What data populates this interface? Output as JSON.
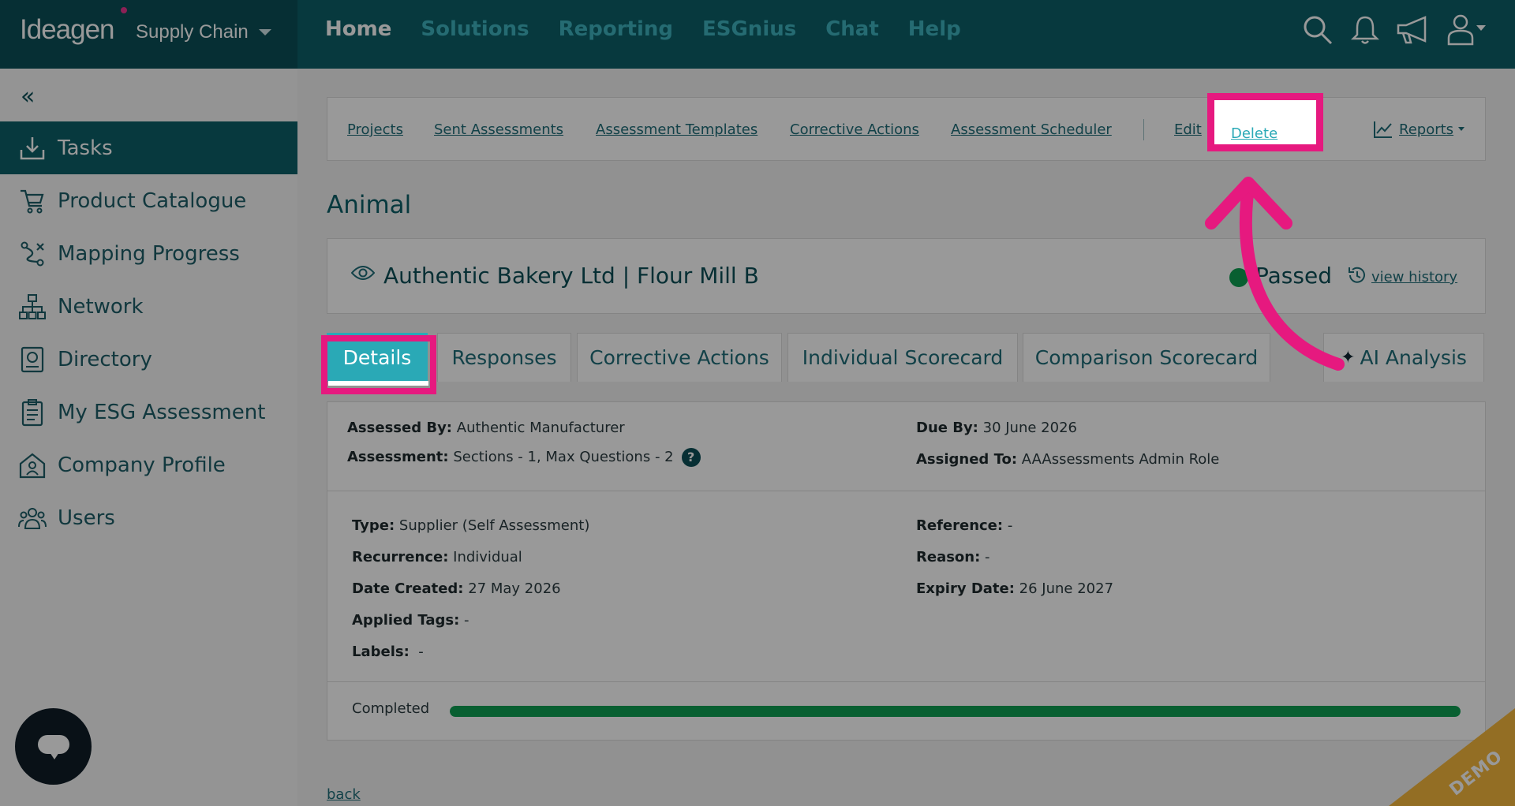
{
  "header": {
    "brand_logo": "Ideagen",
    "brand_product": "Supply Chain",
    "nav": [
      "Home",
      "Solutions",
      "Reporting",
      "ESGnius",
      "Chat",
      "Help"
    ],
    "active_nav": "Home",
    "icons": [
      "search-icon",
      "bell-icon",
      "megaphone-icon",
      "user-icon"
    ]
  },
  "sidebar": {
    "items": [
      {
        "label": "Tasks",
        "icon": "download-tray-icon",
        "active": true
      },
      {
        "label": "Product Catalogue",
        "icon": "cart-icon"
      },
      {
        "label": "Mapping Progress",
        "icon": "route-icon"
      },
      {
        "label": "Network",
        "icon": "network-icon"
      },
      {
        "label": "Directory",
        "icon": "directory-icon"
      },
      {
        "label": "My ESG Assessment",
        "icon": "clipboard-icon"
      },
      {
        "label": "Company Profile",
        "icon": "company-icon"
      },
      {
        "label": "Users",
        "icon": "users-icon"
      }
    ]
  },
  "subnav": {
    "links": [
      "Projects",
      "Sent Assessments",
      "Assessment Templates",
      "Corrective Actions",
      "Assessment Scheduler"
    ],
    "edit": "Edit",
    "delete": "Delete",
    "reports": "Reports"
  },
  "page": {
    "title": "Animal",
    "subject": "Authentic Bakery Ltd | Flour Mill B",
    "status": "Passed",
    "status_color": "#0e9f52",
    "view_history": "view history"
  },
  "tabs": [
    "Details",
    "Responses",
    "Corrective Actions",
    "Individual Scorecard",
    "Comparison Scorecard",
    "AI Analysis"
  ],
  "active_tab": "Details",
  "details": {
    "assessed_by_label": "Assessed By:",
    "assessed_by": "Authentic Manufacturer",
    "due_by_label": "Due By:",
    "due_by": "30 June 2026",
    "assessment_label": "Assessment:",
    "assessment": "Sections - 1, Max Questions - 2",
    "assigned_to_label": "Assigned To:",
    "assigned_to": "AAAssessments Admin Role",
    "type_label": "Type:",
    "type": "Supplier (Self Assessment)",
    "reference_label": "Reference:",
    "reference": "-",
    "recurrence_label": "Recurrence:",
    "recurrence": "Individual",
    "reason_label": "Reason:",
    "reason": "-",
    "date_created_label": "Date Created:",
    "date_created": "27 May 2026",
    "expiry_date_label": "Expiry Date:",
    "expiry_date": "26 June 2027",
    "applied_tags_label": "Applied Tags:",
    "applied_tags": "-",
    "labels_label": "Labels:",
    "labels": "-",
    "completed_label": "Completed",
    "completed_fraction": 1.0
  },
  "back": "back",
  "watermark": "DEMO",
  "colors": {
    "topbar": "#0c5f68",
    "accent": "#2aa9b6",
    "highlight": "#e6197f"
  }
}
